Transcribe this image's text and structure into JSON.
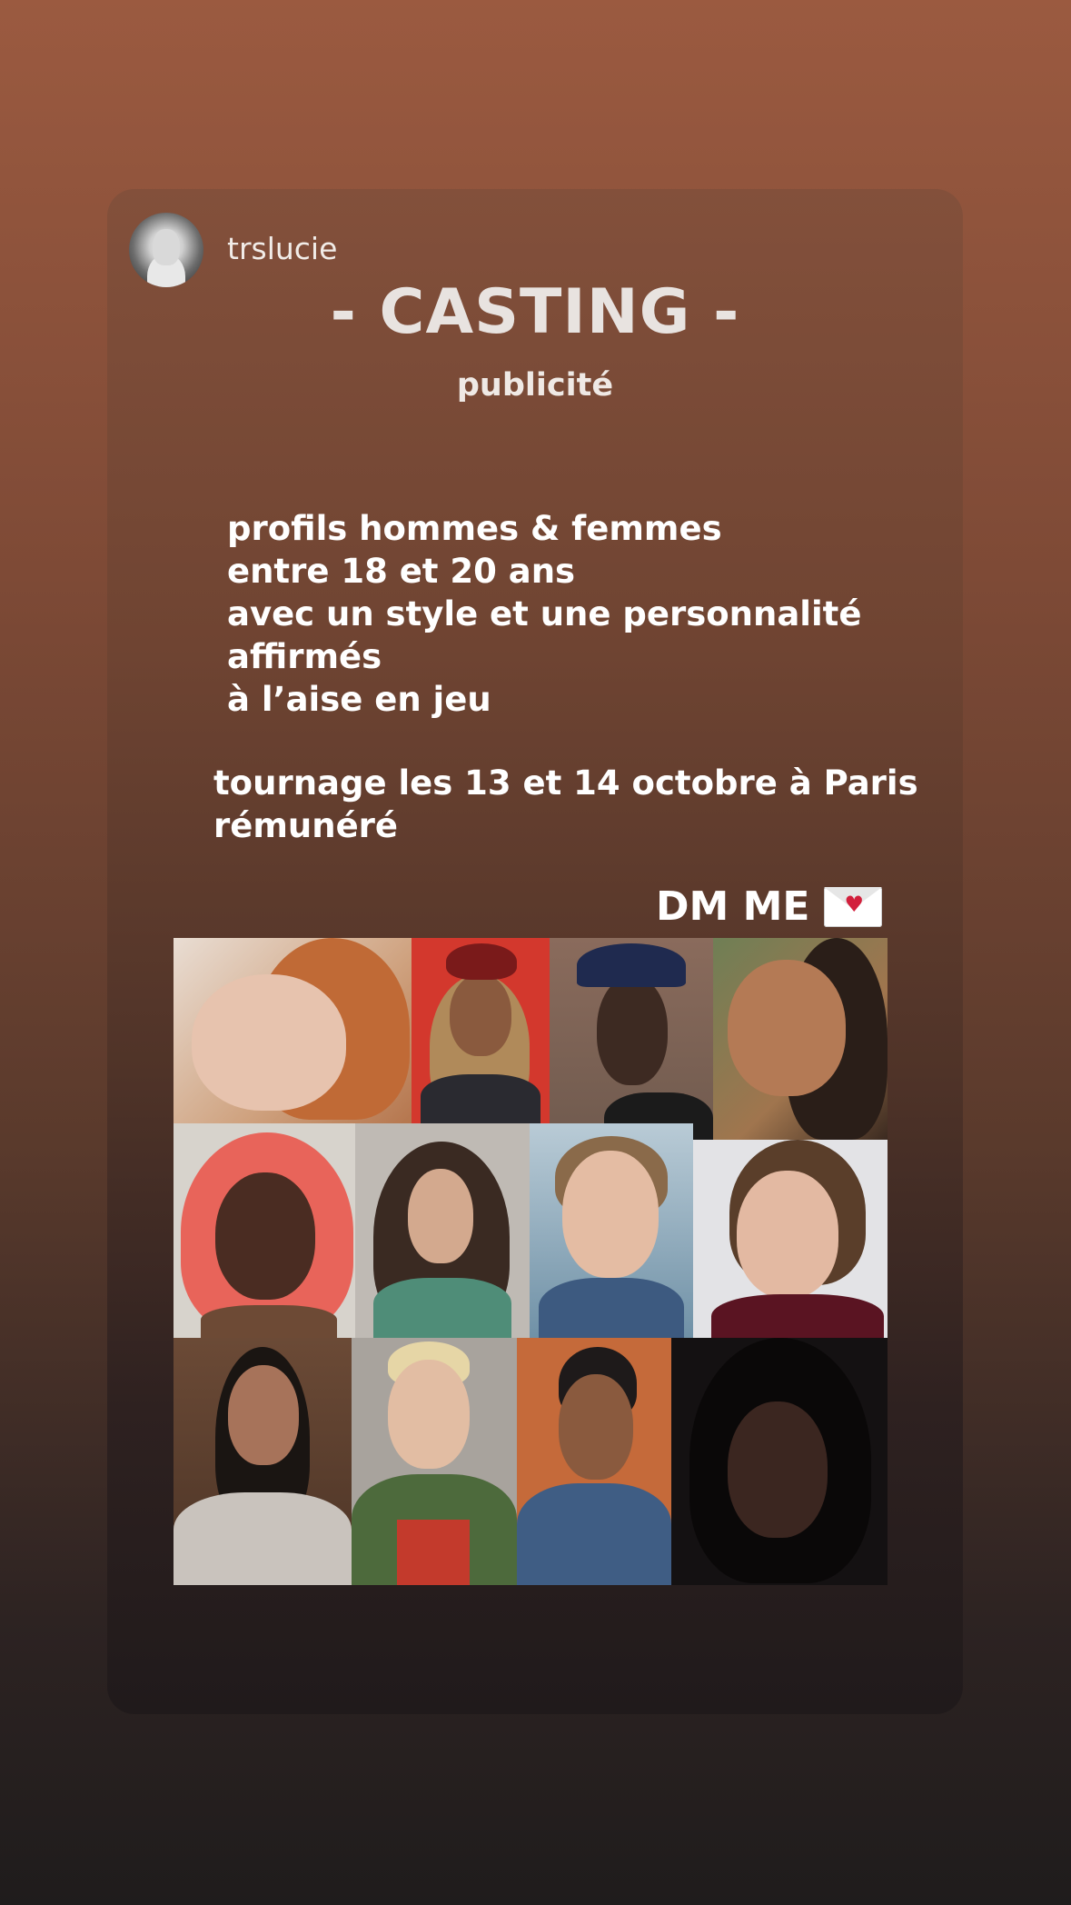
{
  "story": {
    "username": "trslucie",
    "title": "- CASTING -",
    "subtitle": "publicité",
    "requirements": [
      "profils hommes & femmes",
      "entre 18 et 20 ans",
      "avec un style et une personnalité",
      "affirmés",
      "à l’aise en jeu"
    ],
    "details": [
      "tournage les 13 et 14 octobre à Paris",
      "rémunéré"
    ],
    "cta": "DM ME",
    "cta_icon": "love-letter-envelope-icon"
  },
  "colors": {
    "background_top": "#9b5a40",
    "background_bottom": "#1f1c1c",
    "text": "#ffffff"
  }
}
